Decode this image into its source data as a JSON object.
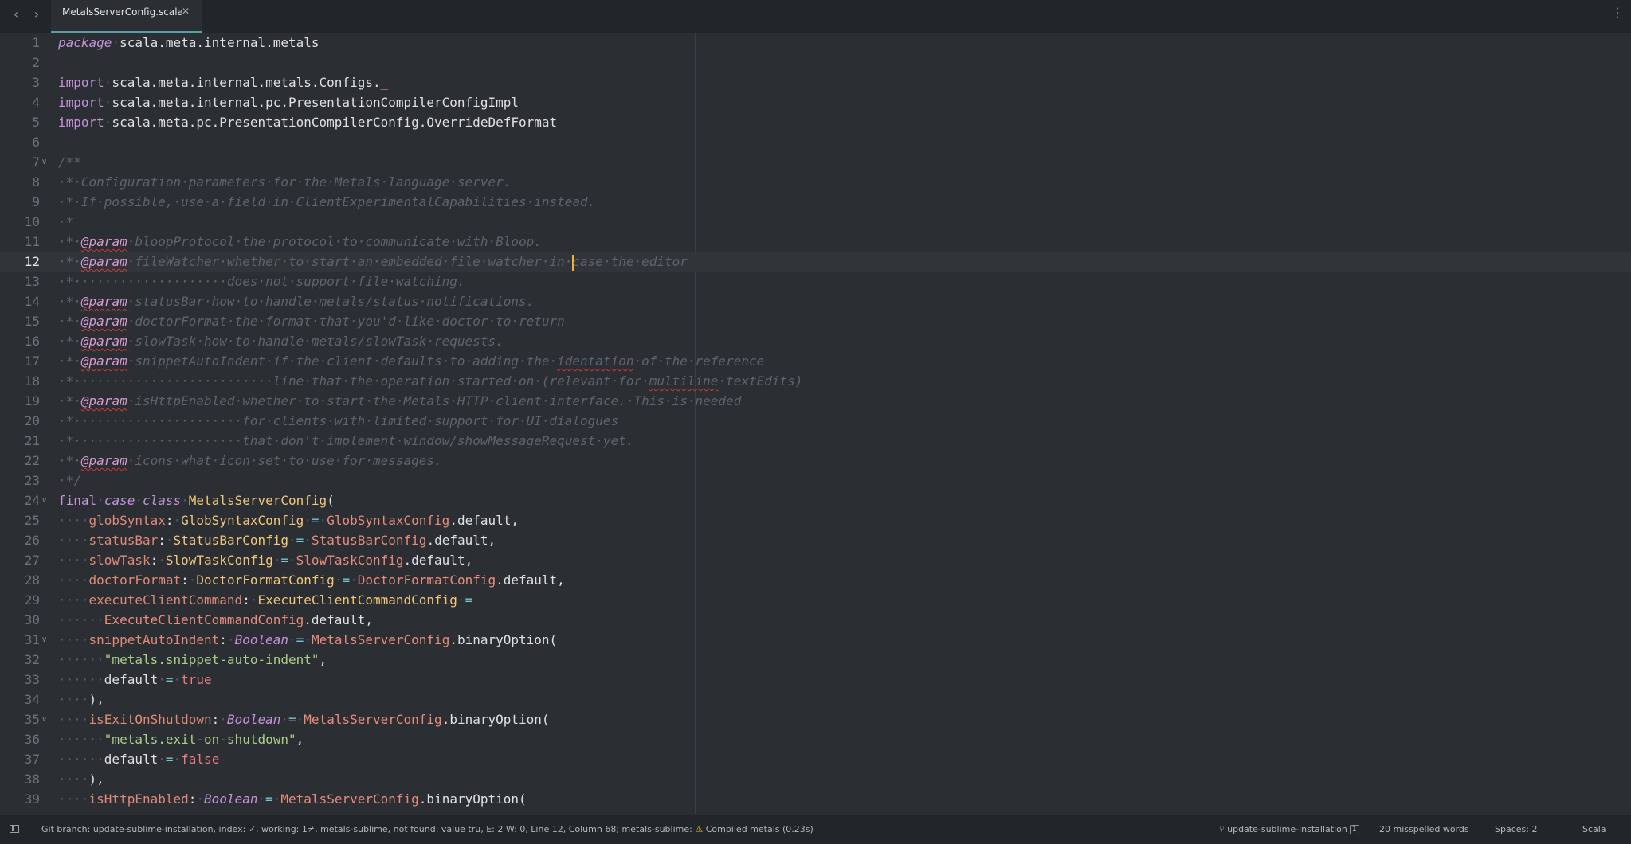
{
  "tab_bar": {
    "back_icon": "chevron-left-icon",
    "forward_icon": "chevron-right-icon",
    "active_tab": {
      "label": "MetalsServerConfig.scala",
      "close_icon": "close-icon"
    },
    "menu_icon": "vertical-ellipsis-icon"
  },
  "editor": {
    "current_line": 12,
    "cursor": {
      "line": 12,
      "column": 68
    },
    "folded_markers": [
      7,
      24,
      31,
      35
    ],
    "lines": [
      {
        "n": "1",
        "tokens": [
          [
            "kw it",
            "package"
          ],
          [
            "ws",
            "·"
          ],
          [
            "",
            "scala.meta.internal.metals"
          ]
        ]
      },
      {
        "n": "2",
        "tokens": []
      },
      {
        "n": "3",
        "tokens": [
          [
            "kw",
            "import"
          ],
          [
            "ws",
            "·"
          ],
          [
            "",
            "scala.meta.internal.metals.Configs."
          ],
          [
            "und",
            "_"
          ]
        ]
      },
      {
        "n": "4",
        "tokens": [
          [
            "kw",
            "import"
          ],
          [
            "ws",
            "·"
          ],
          [
            "",
            "scala.meta.internal.pc.PresentationCompilerConfigImpl"
          ]
        ]
      },
      {
        "n": "5",
        "tokens": [
          [
            "kw",
            "import"
          ],
          [
            "ws",
            "·"
          ],
          [
            "",
            "scala.meta.pc.PresentationCompilerConfig.OverrideDefFormat"
          ]
        ]
      },
      {
        "n": "6",
        "tokens": []
      },
      {
        "n": "7",
        "tokens": [
          [
            "cm",
            "/**"
          ]
        ]
      },
      {
        "n": "8",
        "tokens": [
          [
            "cm",
            "·*·Configuration·parameters·for·the·Metals·language·server."
          ]
        ]
      },
      {
        "n": "9",
        "tokens": [
          [
            "cm",
            "·*·If·possible,·use·a·field·in·ClientExperimentalCapabilities·instead."
          ]
        ]
      },
      {
        "n": "10",
        "tokens": [
          [
            "cm",
            "·*"
          ]
        ]
      },
      {
        "n": "11",
        "tokens": [
          [
            "cm",
            "·*·"
          ],
          [
            "ann squig",
            "@param"
          ],
          [
            "cm",
            "·bloopProtocol·the·protocol·to·communicate·with·Bloop."
          ]
        ]
      },
      {
        "n": "12",
        "tokens": [
          [
            "cm",
            "·*·"
          ],
          [
            "ann squig",
            "@param"
          ],
          [
            "cm",
            "·fileWatcher·whether·to·start·an·embedded·file·watcher·in·"
          ],
          [
            "caret",
            ""
          ],
          [
            "cm",
            "case·the·editor"
          ]
        ]
      },
      {
        "n": "13",
        "tokens": [
          [
            "cm",
            "·*····················does·not·support·file·watching."
          ]
        ]
      },
      {
        "n": "14",
        "tokens": [
          [
            "cm",
            "·*·"
          ],
          [
            "ann squig",
            "@param"
          ],
          [
            "cm",
            "·statusBar·how·to·handle·metals/status·notifications."
          ]
        ]
      },
      {
        "n": "15",
        "tokens": [
          [
            "cm",
            "·*·"
          ],
          [
            "ann squig",
            "@param"
          ],
          [
            "cm",
            "·doctorFormat·the·format·that·you'd·like·doctor·to·return"
          ]
        ]
      },
      {
        "n": "16",
        "tokens": [
          [
            "cm",
            "·*·"
          ],
          [
            "ann squig",
            "@param"
          ],
          [
            "cm",
            "·slowTask·how·to·handle·metals/slowTask·requests."
          ]
        ]
      },
      {
        "n": "17",
        "tokens": [
          [
            "cm",
            "·*·"
          ],
          [
            "ann squig",
            "@param"
          ],
          [
            "cm",
            "·snippetAutoIndent·if·the·client·defaults·to·adding·the·"
          ],
          [
            "cm squig",
            "identation"
          ],
          [
            "cm",
            "·of·the·reference"
          ]
        ]
      },
      {
        "n": "18",
        "tokens": [
          [
            "cm",
            "·*··························line·that·the·operation·started·on·(relevant·for·"
          ],
          [
            "cm squig",
            "multiline"
          ],
          [
            "cm",
            "·textEdits)"
          ]
        ]
      },
      {
        "n": "19",
        "tokens": [
          [
            "cm",
            "·*·"
          ],
          [
            "ann squig",
            "@param"
          ],
          [
            "cm",
            "·isHttpEnabled·whether·to·start·the·Metals·HTTP·client·interface.·This·is·needed"
          ]
        ]
      },
      {
        "n": "20",
        "tokens": [
          [
            "cm",
            "·*······················for·clients·with·limited·support·for·UI·dialogues"
          ]
        ]
      },
      {
        "n": "21",
        "tokens": [
          [
            "cm",
            "·*······················that·don't·implement·window/showMessageRequest·yet."
          ]
        ]
      },
      {
        "n": "22",
        "tokens": [
          [
            "cm",
            "·*·"
          ],
          [
            "ann squig",
            "@param"
          ],
          [
            "cm",
            "·icons·what·icon·set·to·use·for·messages."
          ]
        ]
      },
      {
        "n": "23",
        "tokens": [
          [
            "cm",
            "·*/"
          ]
        ]
      },
      {
        "n": "24",
        "tokens": [
          [
            "kw",
            "final"
          ],
          [
            "ws",
            "·"
          ],
          [
            "kw it",
            "case"
          ],
          [
            "ws",
            "·"
          ],
          [
            "kw it",
            "class"
          ],
          [
            "ws",
            "·"
          ],
          [
            "typ",
            "MetalsServerConfig"
          ],
          [
            "",
            "("
          ]
        ]
      },
      {
        "n": "25",
        "tokens": [
          [
            "ws",
            "····"
          ],
          [
            "fld",
            "globSyntax"
          ],
          [
            "",
            ":"
          ],
          [
            "ws",
            "·"
          ],
          [
            "typ",
            "GlobSyntaxConfig"
          ],
          [
            "ws",
            "·"
          ],
          [
            "op",
            "="
          ],
          [
            "ws",
            "·"
          ],
          [
            "cls",
            "GlobSyntaxConfig"
          ],
          [
            "",
            ".default,"
          ]
        ]
      },
      {
        "n": "26",
        "tokens": [
          [
            "ws",
            "····"
          ],
          [
            "fld",
            "statusBar"
          ],
          [
            "",
            ":"
          ],
          [
            "ws",
            "·"
          ],
          [
            "typ",
            "StatusBarConfig"
          ],
          [
            "ws",
            "·"
          ],
          [
            "op",
            "="
          ],
          [
            "ws",
            "·"
          ],
          [
            "cls",
            "StatusBarConfig"
          ],
          [
            "",
            ".default,"
          ]
        ]
      },
      {
        "n": "27",
        "tokens": [
          [
            "ws",
            "····"
          ],
          [
            "fld",
            "slowTask"
          ],
          [
            "",
            ":"
          ],
          [
            "ws",
            "·"
          ],
          [
            "typ",
            "SlowTaskConfig"
          ],
          [
            "ws",
            "·"
          ],
          [
            "op",
            "="
          ],
          [
            "ws",
            "·"
          ],
          [
            "cls",
            "SlowTaskConfig"
          ],
          [
            "",
            ".default,"
          ]
        ]
      },
      {
        "n": "28",
        "tokens": [
          [
            "ws",
            "····"
          ],
          [
            "fld",
            "doctorFormat"
          ],
          [
            "",
            ":"
          ],
          [
            "ws",
            "·"
          ],
          [
            "typ",
            "DoctorFormatConfig"
          ],
          [
            "ws",
            "·"
          ],
          [
            "op",
            "="
          ],
          [
            "ws",
            "·"
          ],
          [
            "cls",
            "DoctorFormatConfig"
          ],
          [
            "",
            ".default,"
          ]
        ]
      },
      {
        "n": "29",
        "tokens": [
          [
            "ws",
            "····"
          ],
          [
            "fld",
            "executeClientCommand"
          ],
          [
            "",
            ":"
          ],
          [
            "ws",
            "·"
          ],
          [
            "typ",
            "ExecuteClientCommandConfig"
          ],
          [
            "ws",
            "·"
          ],
          [
            "op",
            "="
          ]
        ]
      },
      {
        "n": "30",
        "tokens": [
          [
            "ws",
            "······"
          ],
          [
            "cls",
            "ExecuteClientCommandConfig"
          ],
          [
            "",
            ".default,"
          ]
        ]
      },
      {
        "n": "31",
        "tokens": [
          [
            "ws",
            "····"
          ],
          [
            "fld",
            "snippetAutoIndent"
          ],
          [
            "",
            ":"
          ],
          [
            "ws",
            "·"
          ],
          [
            "kw it",
            "Boolean"
          ],
          [
            "ws",
            "·"
          ],
          [
            "op",
            "="
          ],
          [
            "ws",
            "·"
          ],
          [
            "cls",
            "MetalsServerConfig"
          ],
          [
            "",
            ".binaryOption("
          ]
        ]
      },
      {
        "n": "32",
        "tokens": [
          [
            "ws",
            "······"
          ],
          [
            "str",
            "\"metals.snippet-auto-indent\""
          ],
          [
            "",
            ","
          ]
        ]
      },
      {
        "n": "33",
        "tokens": [
          [
            "ws",
            "······"
          ],
          [
            "",
            "default"
          ],
          [
            "ws",
            "·"
          ],
          [
            "op",
            "="
          ],
          [
            "ws",
            "·"
          ],
          [
            "bool",
            "true"
          ]
        ]
      },
      {
        "n": "34",
        "tokens": [
          [
            "ws",
            "····"
          ],
          [
            "",
            "),"
          ]
        ]
      },
      {
        "n": "35",
        "tokens": [
          [
            "ws",
            "····"
          ],
          [
            "fld",
            "isExitOnShutdown"
          ],
          [
            "",
            ":"
          ],
          [
            "ws",
            "·"
          ],
          [
            "kw it",
            "Boolean"
          ],
          [
            "ws",
            "·"
          ],
          [
            "op",
            "="
          ],
          [
            "ws",
            "·"
          ],
          [
            "cls",
            "MetalsServerConfig"
          ],
          [
            "",
            ".binaryOption("
          ]
        ]
      },
      {
        "n": "36",
        "tokens": [
          [
            "ws",
            "······"
          ],
          [
            "str",
            "\"metals.exit-on-shutdown\""
          ],
          [
            "",
            ","
          ]
        ]
      },
      {
        "n": "37",
        "tokens": [
          [
            "ws",
            "······"
          ],
          [
            "",
            "default"
          ],
          [
            "ws",
            "·"
          ],
          [
            "op",
            "="
          ],
          [
            "ws",
            "·"
          ],
          [
            "bool",
            "false"
          ]
        ]
      },
      {
        "n": "38",
        "tokens": [
          [
            "ws",
            "····"
          ],
          [
            "",
            "),"
          ]
        ]
      },
      {
        "n": "39",
        "tokens": [
          [
            "ws",
            "····"
          ],
          [
            "fld",
            "isHttpEnabled"
          ],
          [
            "",
            ":"
          ],
          [
            "ws",
            "·"
          ],
          [
            "kw it",
            "Boolean"
          ],
          [
            "ws",
            "·"
          ],
          [
            "op",
            "="
          ],
          [
            "ws",
            "·"
          ],
          [
            "cls",
            "MetalsServerConfig"
          ],
          [
            "",
            ".binaryOption("
          ]
        ]
      }
    ]
  },
  "status_bar": {
    "panel_toggle_icon": "sidebar-toggle-icon",
    "git_info": "Git branch: update-sublime-installation, index: ✓, working: 1≠, metals-sublime, not found: value tru, E: 2 W: 0, Line 12, Column 68; metals-sublime:",
    "warning_icon": "warning-icon",
    "compile_status": "Compiled metals (0.23s)",
    "branch_icon": "git-branch-icon",
    "branch_name": "update-sublime-installation",
    "branch_count": "1",
    "misspelled": "20 misspelled words",
    "spaces": "Spaces: 2",
    "syntax": "Scala"
  }
}
